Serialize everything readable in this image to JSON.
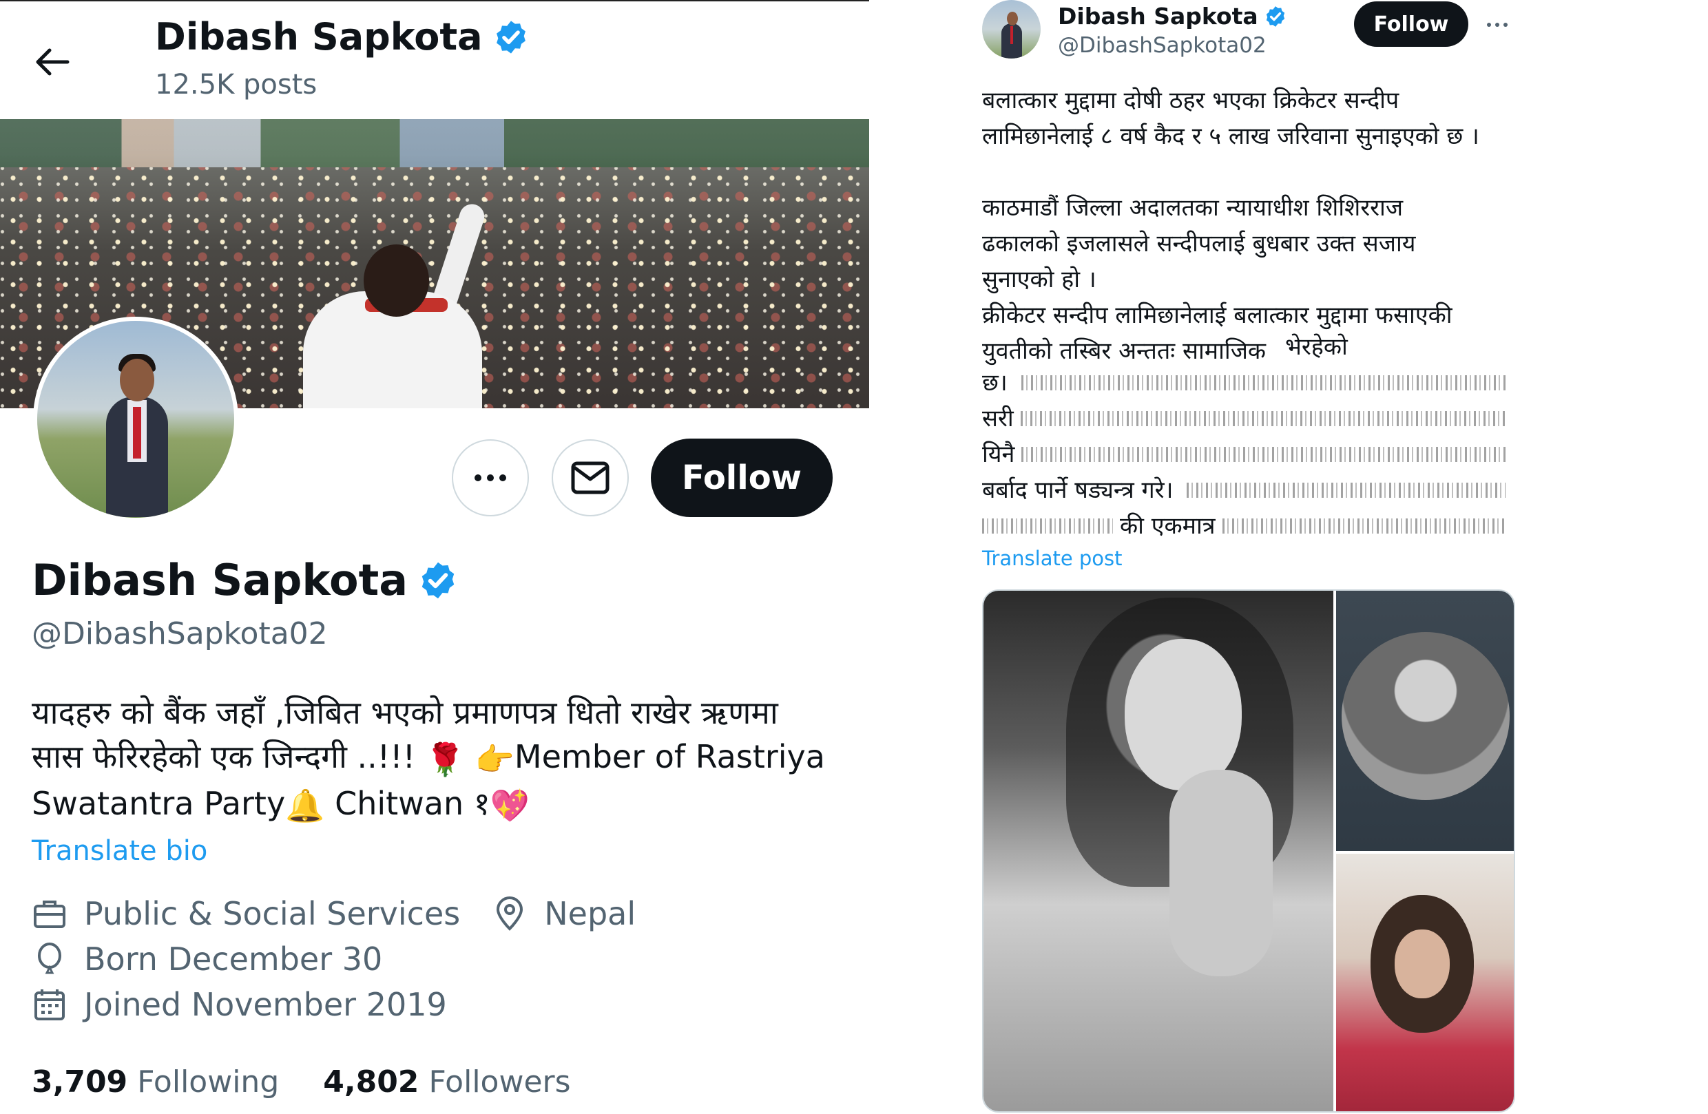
{
  "profile_header": {
    "name": "Dibash Sapkota",
    "posts": "12.5K posts"
  },
  "profile": {
    "name": "Dibash Sapkota",
    "handle": "@DibashSapkota02",
    "follow_label": "Follow",
    "bio_line1": "यादहरु को बैंक जहाँ ,जिबित भएको प्रमाणपत्र धितो राखेर ऋणमा",
    "bio_line2a": "सास फेरिरहेको एक जिन्दगी ..!!! ",
    "bio_rose": "🌹",
    "bio_point": "👉",
    "bio_line2b": "Member of Rastriya",
    "bio_line3a": "Swatantra Party",
    "bio_bell": "🔔",
    "bio_line3b": " Chitwan १",
    "bio_heart": "💖",
    "translate_bio": "Translate bio",
    "category": "Public & Social Services",
    "location": "Nepal",
    "born": "Born December 30",
    "joined": "Joined November 2019",
    "following_count": "3,709",
    "following_label": "Following",
    "followers_count": "4,802",
    "followers_label": "Followers"
  },
  "tweet": {
    "name": "Dibash Sapkota",
    "handle": "@DibashSapkota02",
    "follow_label": "Follow",
    "text": "बलात्कार मुद्दामा दोषी ठहर भएका क्रिकेटर सन्दीप\nलामिछानेलाई ८ वर्ष कैद र ५ लाख जरिवाना सुनाइएको छ ।\n\nकाठमाडौं जिल्ला अदालतका न्यायाधीश शिशिरराज\nढकालको इजलासले सन्दीपलाई बुधबार उक्त सजाय\nसुनाएको हो ।\nक्रीकेटर सन्दीप लामिछानेलाई बलात्कार मुद्दामा फसाएकी\nयुवतीको तस्बिर अन्ततः सामाजिक",
    "garbled_fragments": [
      "भेरहेको",
      "छ।",
      "सरी",
      "यिनै",
      "बर्बाद पार्ने षड्यन्त्र गरे।",
      "की एकमात्र"
    ],
    "translate_label": "Translate post"
  },
  "colors": {
    "accent": "#1d9bf0",
    "verified": "#1d9bf0",
    "text_secondary": "#536471",
    "button_dark": "#0f1419"
  },
  "icons": [
    "back-arrow-icon",
    "verified-badge-icon",
    "more-icon",
    "mail-icon",
    "briefcase-icon",
    "location-pin-icon",
    "balloon-icon",
    "calendar-icon"
  ]
}
